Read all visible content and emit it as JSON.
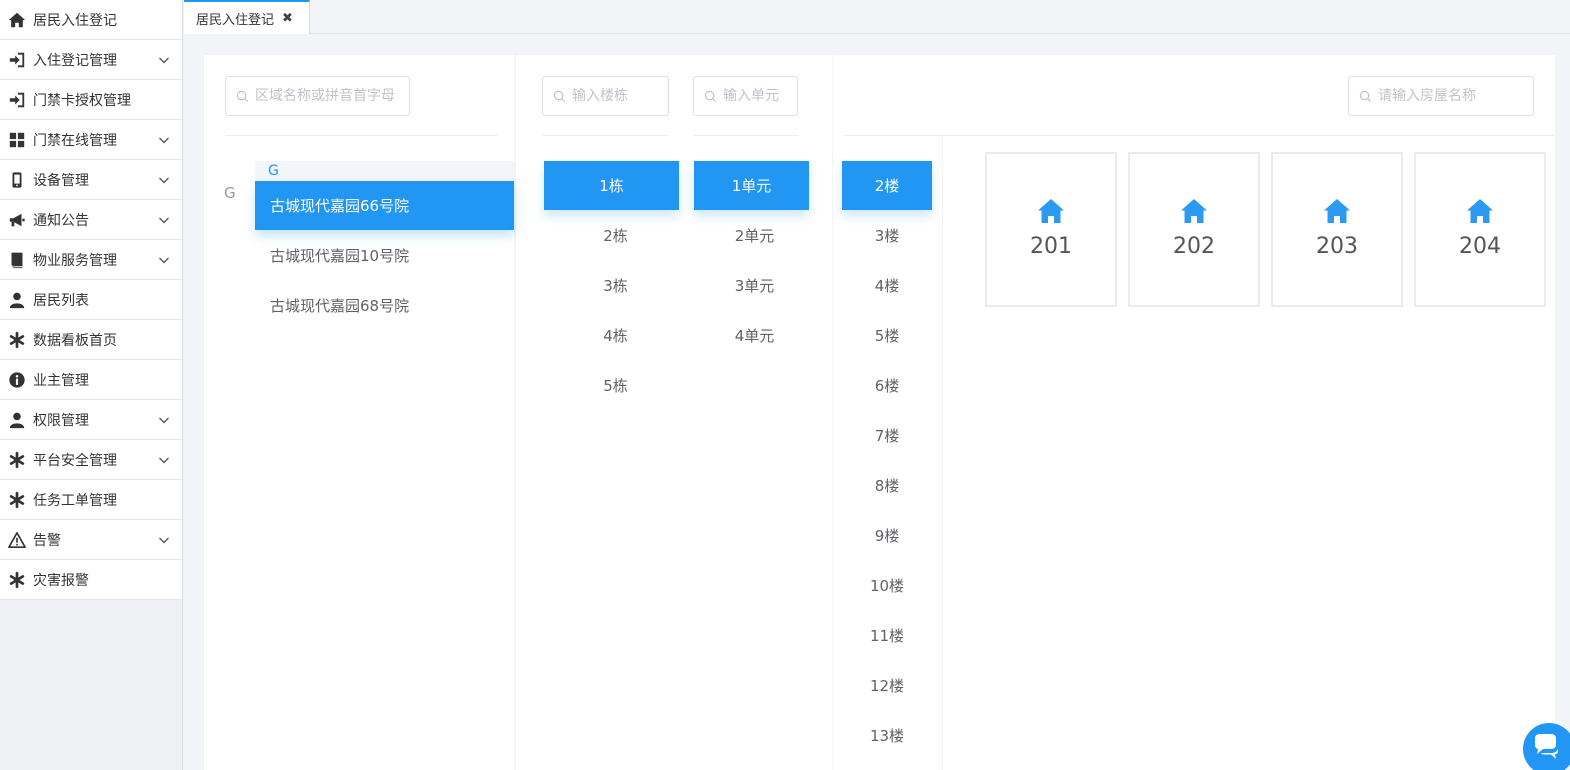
{
  "sidebar": {
    "items": [
      {
        "label": "居民入住登记",
        "icon": "home-icon",
        "expandable": false
      },
      {
        "label": "入住登记管理",
        "icon": "sign-in-icon",
        "expandable": true
      },
      {
        "label": "门禁卡授权管理",
        "icon": "sign-in-icon",
        "expandable": false
      },
      {
        "label": "门禁在线管理",
        "icon": "grid-icon",
        "expandable": true
      },
      {
        "label": "设备管理",
        "icon": "mobile-icon",
        "expandable": true
      },
      {
        "label": "通知公告",
        "icon": "bullhorn-icon",
        "expandable": true
      },
      {
        "label": "物业服务管理",
        "icon": "book-icon",
        "expandable": true
      },
      {
        "label": "居民列表",
        "icon": "user-icon",
        "expandable": false
      },
      {
        "label": "数据看板首页",
        "icon": "asterisk-icon",
        "expandable": false
      },
      {
        "label": "业主管理",
        "icon": "info-icon",
        "expandable": false
      },
      {
        "label": "权限管理",
        "icon": "user-icon",
        "expandable": true
      },
      {
        "label": "平台安全管理",
        "icon": "asterisk-icon",
        "expandable": true
      },
      {
        "label": "任务工单管理",
        "icon": "asterisk-icon",
        "expandable": false
      },
      {
        "label": "告警",
        "icon": "warning-icon",
        "expandable": true
      },
      {
        "label": "灾害报警",
        "icon": "asterisk-icon",
        "expandable": false
      }
    ]
  },
  "tabs": [
    {
      "label": "居民入住登记",
      "close": "✖"
    }
  ],
  "area": {
    "search_placeholder": "区域名称或拼音首字母",
    "index_letter": "G",
    "group_header": "G",
    "items": [
      "古城现代嘉园66号院",
      "古城现代嘉园10号院",
      "古城现代嘉园68号院"
    ],
    "active_index": 0
  },
  "building": {
    "search_placeholder": "输入楼栋",
    "items": [
      "1栋",
      "2栋",
      "3栋",
      "4栋",
      "5栋"
    ],
    "active_index": 0
  },
  "unit": {
    "search_placeholder": "输入单元",
    "items": [
      "1单元",
      "2单元",
      "3单元",
      "4单元"
    ],
    "active_index": 0
  },
  "floor": {
    "items": [
      "2楼",
      "3楼",
      "4楼",
      "5楼",
      "6楼",
      "7楼",
      "8楼",
      "9楼",
      "10楼",
      "11楼",
      "12楼",
      "13楼"
    ],
    "active_index": 0
  },
  "rooms": {
    "search_placeholder": "请输入房屋名称",
    "items": [
      "201",
      "202",
      "203",
      "204"
    ]
  },
  "colors": {
    "accent": "#2196f3",
    "icon_dark": "#333333",
    "house_icon": "#2b9af3"
  }
}
